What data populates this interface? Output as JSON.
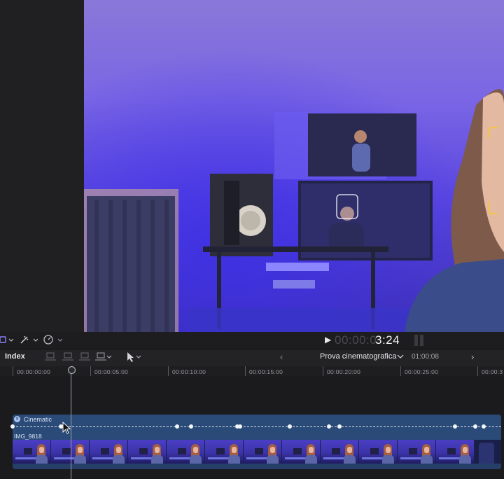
{
  "timecode": {
    "play_glyph": "▶",
    "dim_part": "00:00:0",
    "bright_part": "3:24"
  },
  "toolbar": {
    "index_label": "Index",
    "nav_back": "‹",
    "nav_forward": "›",
    "project_title": "Prova cinematografica",
    "project_chevron": "⌄",
    "project_duration": "01:00:08"
  },
  "ruler": {
    "ticks": [
      "00:00:00:00",
      "00:00:05:00",
      "00:00:10:00",
      "00:00:15:00",
      "00:00:20:00",
      "00:00:25:00",
      "00:00:3"
    ]
  },
  "clip": {
    "effect_label": "Cinematic",
    "effect_badge": "×",
    "name": "IMG_9818"
  },
  "icons": {
    "tool_glyph": "✦",
    "speed_glyph": "◔",
    "arrow_glyph": "▸"
  }
}
